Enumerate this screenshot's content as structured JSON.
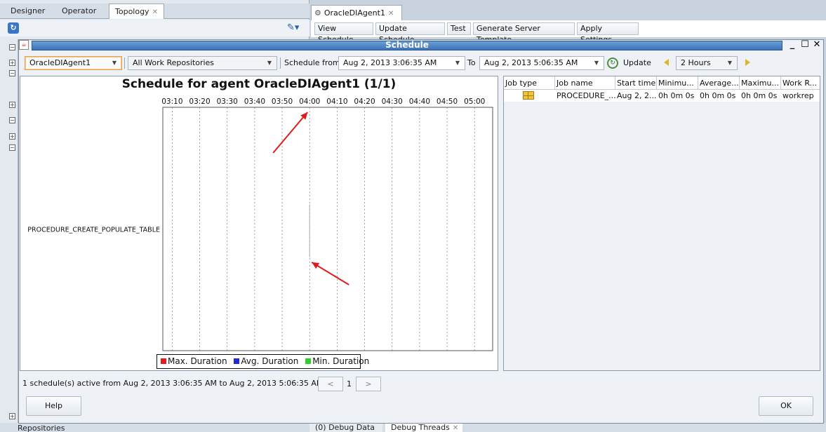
{
  "ide": {
    "left_tabs": [
      "Designer",
      "Operator",
      "Topology"
    ],
    "agent_tab": "OracleDIAgent1",
    "toolbar": [
      "View Schedule",
      "Update Schedule",
      "Test",
      "Generate Server Template",
      "Apply Settings"
    ],
    "bottom_left": "Repositories",
    "bottom_tabs": [
      "(0) Debug Data",
      "Debug Threads"
    ]
  },
  "dialog": {
    "title": "Schedule",
    "agent_select": "OracleDIAgent1",
    "repo_select": "All Work Repositories",
    "schedule_from_label": "Schedule from",
    "from_value": "Aug 2, 2013 3:06:35 AM",
    "to_label": "To",
    "to_value": "Aug 2, 2013 5:06:35 AM",
    "update_label": "Update",
    "range_select": "2 Hours",
    "status": "1 schedule(s) active from Aug 2, 2013 3:06:35 AM to Aug 2, 2013 5:06:35 AM",
    "pager": {
      "prev": "<",
      "page": "1",
      "next": ">"
    },
    "help": "Help",
    "ok": "OK"
  },
  "chart_data": {
    "type": "gantt",
    "title": "Schedule for agent OracleDIAgent1 (1/1)",
    "time_ticks": [
      "03:10",
      "03:20",
      "03:30",
      "03:40",
      "03:50",
      "04:00",
      "04:10",
      "04:20",
      "04:30",
      "04:40",
      "04:50",
      "05:00"
    ],
    "x_range": [
      "03:06:35",
      "05:06:35"
    ],
    "rows": [
      "PROCEDURE_CREATE_POPULATE_TABLE"
    ],
    "scheduled_marks": [
      {
        "row": "PROCEDURE_CREATE_POPULATE_TABLE",
        "time": "04:00"
      }
    ],
    "legend": [
      {
        "label": "Max. Duration",
        "color": "#e8191c"
      },
      {
        "label": "Avg. Duration",
        "color": "#1f2bd8"
      },
      {
        "label": "Min. Duration",
        "color": "#2bd12b"
      }
    ],
    "grid": true
  },
  "table": {
    "columns": [
      "Job type",
      "Job name",
      "Start time",
      "Minimu...",
      "Average...",
      "Maximu...",
      "Work R..."
    ],
    "rows": [
      [
        "",
        "PROCEDURE_...",
        "Aug 2, 2...",
        "0h 0m 0s",
        "0h 0m 0s",
        "0h 0m 0s",
        "workrep"
      ]
    ]
  },
  "colors": {
    "title_bar": "#3e72b6",
    "arrow": "#e01b1b",
    "accent_dropdown": "#e9a04a"
  }
}
